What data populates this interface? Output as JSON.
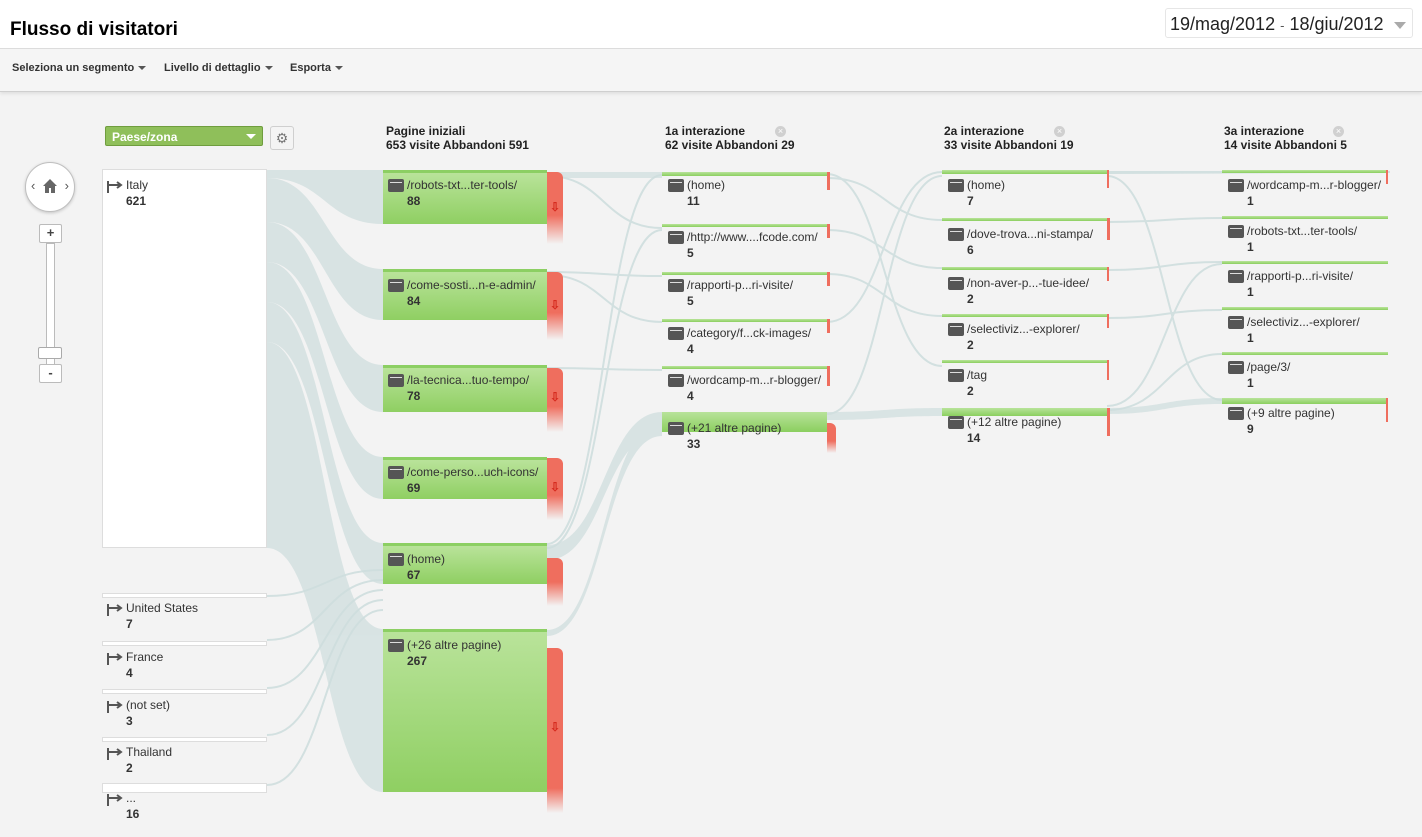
{
  "header": {
    "title": "Flusso di visitatori",
    "date_start": "19/mag/2012",
    "date_sep": "-",
    "date_end": "18/giu/2012"
  },
  "toolbar": {
    "segment": "Seleziona un segmento",
    "detail": "Livello di dettaglio",
    "export": "Esporta"
  },
  "controls": {
    "dimension": "Paese/zona",
    "zoom_in": "+",
    "zoom_out": "-"
  },
  "columns": [
    {
      "title": "Pagine iniziali",
      "sub": "653 visite Abbandoni 591"
    },
    {
      "title": "1a interazione",
      "sub": "62 visite Abbandoni 29"
    },
    {
      "title": "2a interazione",
      "sub": "33 visite Abbandoni 19"
    },
    {
      "title": "3a interazione",
      "sub": "14 visite Abbandoni 5"
    }
  ],
  "sources": [
    {
      "label": "Italy",
      "count": "621"
    },
    {
      "label": "United States",
      "count": "7"
    },
    {
      "label": "France",
      "count": "4"
    },
    {
      "label": "(not set)",
      "count": "3"
    },
    {
      "label": "Thailand",
      "count": "2"
    },
    {
      "label": "...",
      "count": "16"
    }
  ],
  "start_pages": [
    {
      "label": "/robots-txt...ter-tools/",
      "count": "88"
    },
    {
      "label": "/come-sosti...n-e-admin/",
      "count": "84"
    },
    {
      "label": "/la-tecnica...tuo-tempo/",
      "count": "78"
    },
    {
      "label": "/come-perso...uch-icons/",
      "count": "69"
    },
    {
      "label": "(home)",
      "count": "67"
    },
    {
      "label": "(+26 altre pagine)",
      "count": "267"
    }
  ],
  "step1": [
    {
      "label": "(home)",
      "count": "11"
    },
    {
      "label": "/http://www....fcode.com/",
      "count": "5"
    },
    {
      "label": "/rapporti-p...ri-visite/",
      "count": "5"
    },
    {
      "label": "/category/f...ck-images/",
      "count": "4"
    },
    {
      "label": "/wordcamp-m...r-blogger/",
      "count": "4"
    },
    {
      "label": "(+21 altre pagine)",
      "count": "33"
    }
  ],
  "step2": [
    {
      "label": "(home)",
      "count": "7"
    },
    {
      "label": "/dove-trova...ni-stampa/",
      "count": "6"
    },
    {
      "label": "/non-aver-p...-tue-idee/",
      "count": "2"
    },
    {
      "label": "/selectiviz...-explorer/",
      "count": "2"
    },
    {
      "label": "/tag",
      "count": "2"
    },
    {
      "label": "(+12 altre pagine)",
      "count": "14"
    }
  ],
  "step3": [
    {
      "label": "/wordcamp-m...r-blogger/",
      "count": "1"
    },
    {
      "label": "/robots-txt...ter-tools/",
      "count": "1"
    },
    {
      "label": "/rapporti-p...ri-visite/",
      "count": "1"
    },
    {
      "label": "/selectiviz...-explorer/",
      "count": "1"
    },
    {
      "label": "/page/3/",
      "count": "1"
    },
    {
      "label": "(+9 altre pagine)",
      "count": "9"
    }
  ]
}
